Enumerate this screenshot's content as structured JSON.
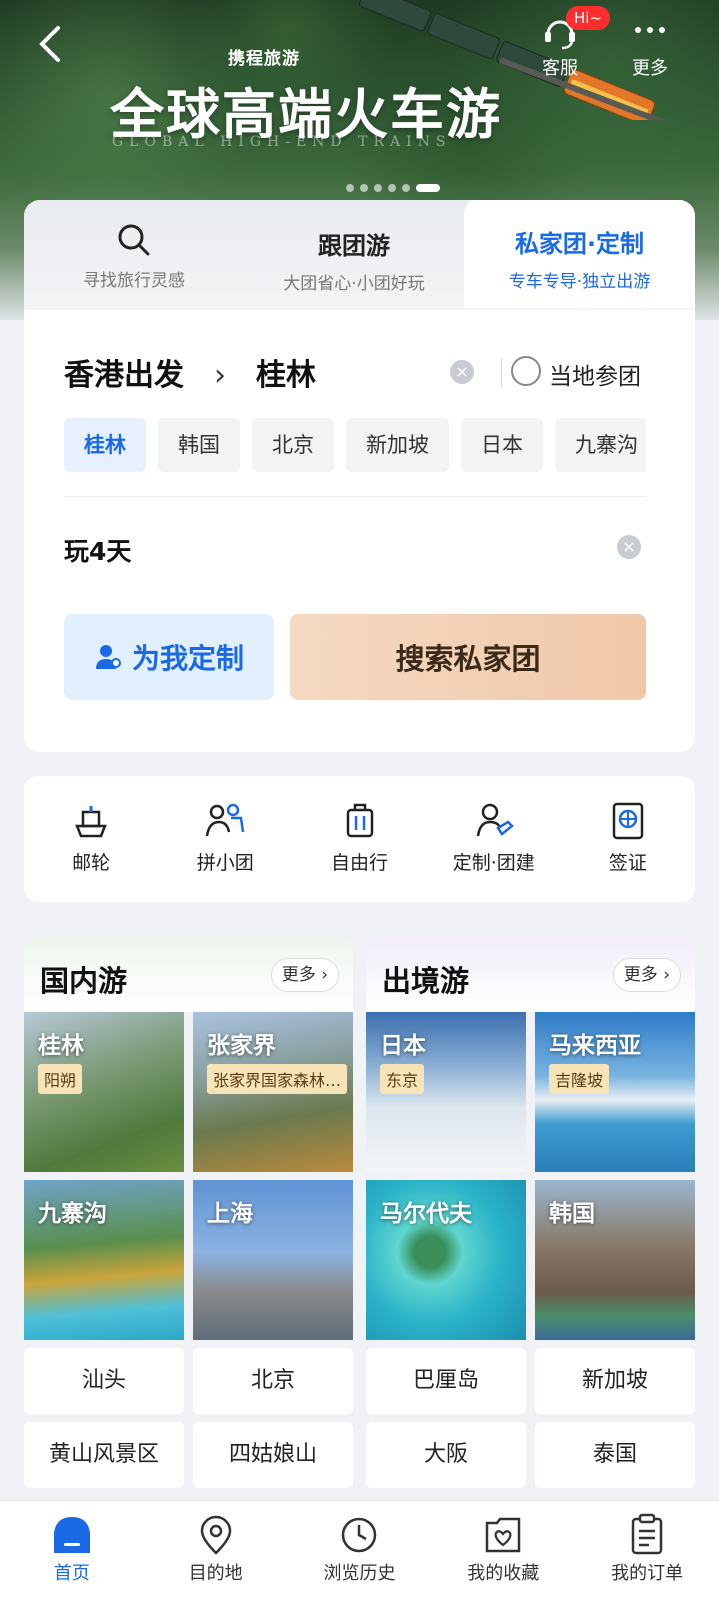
{
  "hero": {
    "brand": "携程旅游",
    "title": "全球高端火车游",
    "subtitle": "GLOBAL HIGH-END TRAINS",
    "service_label": "客服",
    "service_badge": "Hi~",
    "more_label": "更多"
  },
  "search": {
    "tabs": [
      {
        "title": "",
        "subtitle": "寻找旅行灵感",
        "icon": "search-icon"
      },
      {
        "title": "跟团游",
        "subtitle": "大团省心·小团好玩"
      },
      {
        "title": "私家团·定制",
        "subtitle": "专车专导·独立出游",
        "active": true
      }
    ],
    "origin": "香港出发",
    "destination": "桂林",
    "local_join_label": "当地参团",
    "chips": [
      "桂林",
      "韩国",
      "北京",
      "新加坡",
      "日本",
      "九寨沟"
    ],
    "days": "玩4天",
    "custom_button": "为我定制",
    "search_button": "搜索私家团"
  },
  "services": [
    {
      "label": "邮轮",
      "icon": "cruise-icon"
    },
    {
      "label": "拼小团",
      "icon": "small-group-icon"
    },
    {
      "label": "自由行",
      "icon": "luggage-icon"
    },
    {
      "label": "定制·团建",
      "icon": "custom-team-icon"
    },
    {
      "label": "签证",
      "icon": "visa-icon"
    }
  ],
  "domestic": {
    "title": "国内游",
    "more": "更多",
    "tiles": [
      {
        "name": "桂林",
        "tag": "阳朔"
      },
      {
        "name": "张家界",
        "tag": "张家界国家森林…"
      },
      {
        "name": "九寨沟",
        "tag": ""
      },
      {
        "name": "上海",
        "tag": ""
      }
    ],
    "buttons": [
      "汕头",
      "北京",
      "黄山风景区",
      "四姑娘山"
    ]
  },
  "outbound": {
    "title": "出境游",
    "more": "更多",
    "tiles": [
      {
        "name": "日本",
        "tag": "东京"
      },
      {
        "name": "马来西亚",
        "tag": "吉隆坡"
      },
      {
        "name": "马尔代夫",
        "tag": ""
      },
      {
        "name": "韩国",
        "tag": ""
      }
    ],
    "buttons": [
      "巴厘岛",
      "新加坡",
      "大阪",
      "泰国"
    ]
  },
  "tabbar": [
    {
      "label": "首页",
      "icon": "home-icon",
      "active": true
    },
    {
      "label": "目的地",
      "icon": "location-icon"
    },
    {
      "label": "浏览历史",
      "icon": "clock-icon"
    },
    {
      "label": "我的收藏",
      "icon": "favorite-icon"
    },
    {
      "label": "我的订单",
      "icon": "order-icon"
    }
  ],
  "colors": {
    "accent": "#1a6ae6",
    "badge": "#ff2d2d"
  }
}
